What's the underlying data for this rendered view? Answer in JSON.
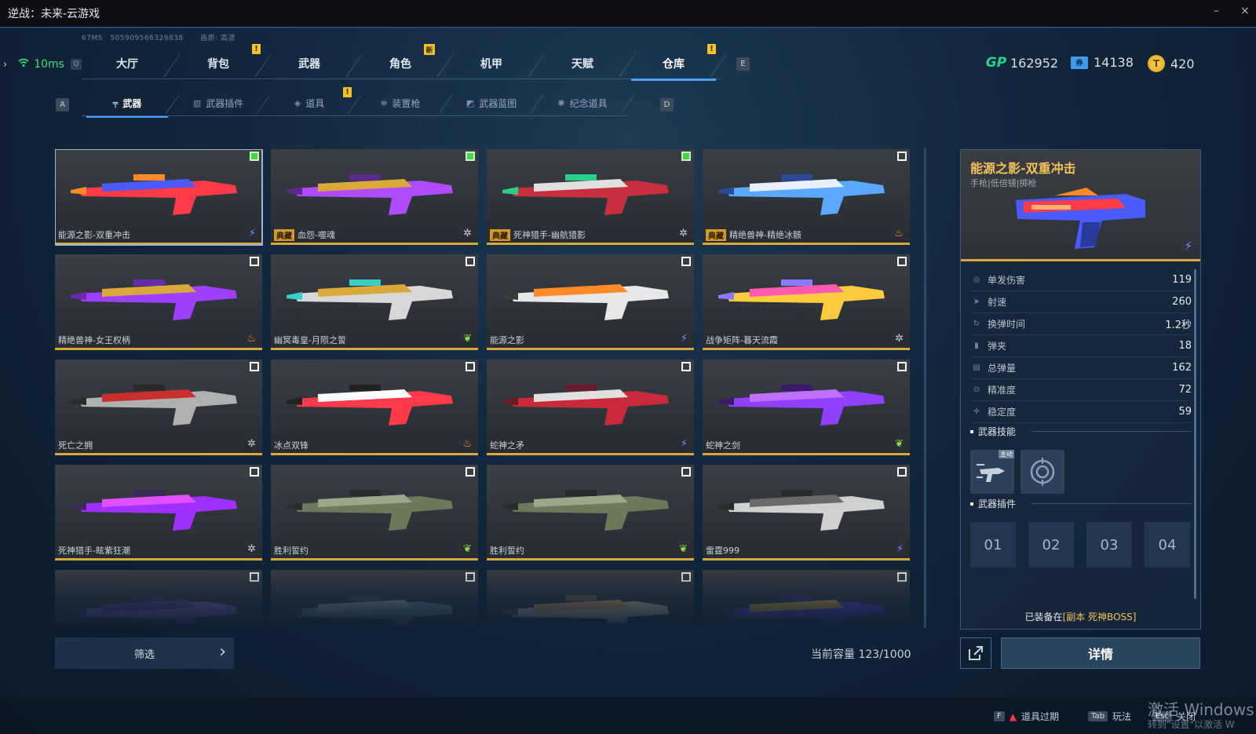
{
  "window": {
    "title": "逆战：未来-云游戏",
    "minimize": "–",
    "close": "×"
  },
  "meta": {
    "latency_small": "67MS",
    "session_id": "505909566329838",
    "quality": "画质: 高清"
  },
  "ping": {
    "label": "10ms",
    "key": "Q"
  },
  "main_tabs": [
    {
      "label": "大厅",
      "badge": ""
    },
    {
      "label": "背包",
      "badge": "!"
    },
    {
      "label": "武器",
      "badge": ""
    },
    {
      "label": "角色",
      "badge": "新"
    },
    {
      "label": "机甲",
      "badge": ""
    },
    {
      "label": "天赋",
      "badge": ""
    },
    {
      "label": "仓库",
      "badge": "!",
      "active": true
    }
  ],
  "main_tabs_key_right": "E",
  "currency": [
    {
      "icon": "gp-icon",
      "symbol": "GP",
      "value": "162952"
    },
    {
      "icon": "ticket-icon",
      "symbol": "券",
      "value": "14138"
    },
    {
      "icon": "coin-icon",
      "symbol": "T",
      "value": "420"
    }
  ],
  "sub_tabs": {
    "key_left": "A",
    "key_right": "D",
    "items": [
      {
        "label": "武器",
        "icon": "gun-icon",
        "active": true
      },
      {
        "label": "武器插件",
        "icon": "chip-icon"
      },
      {
        "label": "道具",
        "icon": "item-icon",
        "badge": "!"
      },
      {
        "label": "装置枪",
        "icon": "device-icon"
      },
      {
        "label": "武器蓝图",
        "icon": "blueprint-icon"
      },
      {
        "label": "纪念道具",
        "icon": "medal-icon"
      }
    ]
  },
  "weapons": [
    {
      "name": "能源之影-双重冲击",
      "tag": "",
      "type": "bolt",
      "checked": true,
      "selected": true,
      "colors": [
        "#ff3b4a",
        "#4a5cff",
        "#ff8a2a"
      ]
    },
    {
      "name": "血怨-噬魂",
      "tag": "典藏",
      "type": "snow",
      "checked": true,
      "colors": [
        "#b04bff",
        "#d8a93a",
        "#5a2a8a"
      ]
    },
    {
      "name": "死神猎手-幽航猎影",
      "tag": "典藏",
      "type": "snow",
      "checked": true,
      "colors": [
        "#c83040",
        "#e0e0e0",
        "#2ad08a"
      ]
    },
    {
      "name": "精绝兽神-精绝冰骸",
      "tag": "典藏",
      "type": "fire",
      "checked": false,
      "colors": [
        "#5aa8ff",
        "#e8f0ff",
        "#2a4a9a"
      ]
    },
    {
      "name": "精绝兽神-女王权柄",
      "tag": "",
      "type": "fire",
      "checked": false,
      "colors": [
        "#a040ff",
        "#d8a93a",
        "#6a2ab0"
      ]
    },
    {
      "name": "幽冥毒皇-月陨之誓",
      "tag": "",
      "type": "leaf",
      "checked": false,
      "colors": [
        "#d8d8d8",
        "#d8a93a",
        "#3ad0c8"
      ]
    },
    {
      "name": "能源之影",
      "tag": "",
      "type": "bolt",
      "checked": false,
      "colors": [
        "#e8e8e8",
        "#ff8a2a",
        "#3a3a3a"
      ]
    },
    {
      "name": "战争矩阵-暮天流霞",
      "tag": "",
      "type": "snow",
      "checked": false,
      "colors": [
        "#ffcc40",
        "#ff5ab0",
        "#8a7aff"
      ]
    },
    {
      "name": "死亡之拥",
      "tag": "",
      "type": "snow",
      "checked": false,
      "colors": [
        "#b0b0b0",
        "#c83030",
        "#2a2a2a"
      ]
    },
    {
      "name": "冰点双锋",
      "tag": "",
      "type": "fire",
      "checked": false,
      "colors": [
        "#ff3a4a",
        "#ffffff",
        "#222222"
      ]
    },
    {
      "name": "蛇神之矛",
      "tag": "",
      "type": "bolt",
      "checked": false,
      "colors": [
        "#c82a3a",
        "#e0e0e0",
        "#6a1a2a"
      ]
    },
    {
      "name": "蛇神之剑",
      "tag": "",
      "type": "leaf",
      "checked": false,
      "colors": [
        "#9040ff",
        "#c070ff",
        "#3a1a6a"
      ]
    },
    {
      "name": "死神猎手-眩紫狂潮",
      "tag": "",
      "type": "snow",
      "checked": false,
      "colors": [
        "#a030ff",
        "#e050ff",
        "#3a2a5a"
      ]
    },
    {
      "name": "胜利誓约",
      "tag": "",
      "type": "leaf",
      "checked": false,
      "colors": [
        "#6a7a5a",
        "#9aa88a",
        "#2a2e2a"
      ]
    },
    {
      "name": "胜利誓约",
      "tag": "",
      "type": "leaf",
      "checked": false,
      "colors": [
        "#6a7a5a",
        "#9aa88a",
        "#2a2e2a"
      ]
    },
    {
      "name": "雷霆999",
      "tag": "",
      "type": "bolt",
      "checked": false,
      "colors": [
        "#d0d0d0",
        "#6a6a6a",
        "#2a2a2a"
      ]
    },
    {
      "name": "",
      "tag": "",
      "type": "",
      "checked": false,
      "colors": [
        "#8a60c8",
        "#5a4a8a",
        "#3a3a5a"
      ]
    },
    {
      "name": "",
      "tag": "",
      "type": "",
      "checked": false,
      "colors": [
        "#6a8a9a",
        "#8aa0b0",
        "#3a4a5a"
      ]
    },
    {
      "name": "",
      "tag": "",
      "type": "",
      "checked": false,
      "colors": [
        "#d8c8a0",
        "#e0a060",
        "#6a5a4a"
      ]
    },
    {
      "name": "",
      "tag": "",
      "type": "",
      "checked": false,
      "colors": [
        "#6040d0",
        "#d8a93a",
        "#3a3a6a"
      ]
    }
  ],
  "filter": {
    "label": "筛选",
    "chevron": "›"
  },
  "capacity": "当前容量 123/1000",
  "detail": {
    "title": "能源之影-双重冲击",
    "subtitle": "手枪|低倍镜|掷枪",
    "stats": [
      {
        "label": "单发伤害",
        "value": "119"
      },
      {
        "label": "射速",
        "value": "260"
      },
      {
        "label": "换弹时间",
        "value": "1.2秒"
      },
      {
        "label": "弹夹",
        "value": "18"
      },
      {
        "label": "总弹量",
        "value": "162"
      },
      {
        "label": "精准度",
        "value": "72"
      },
      {
        "label": "稳定度",
        "value": "59"
      }
    ],
    "skills_title": "武器技能",
    "skill_main_tag": "主动",
    "plugins_title": "武器插件",
    "plugin_slots": [
      "01",
      "02",
      "03",
      "04"
    ],
    "equipped_prefix": "已装备在",
    "equipped_location": "[副本 死神BOSS]",
    "share_icon": "share-icon",
    "detail_button": "详情"
  },
  "bottom_hints": [
    {
      "key": "F",
      "label": "道具过期",
      "warn": true
    },
    {
      "key": "Tab",
      "label": "玩法"
    },
    {
      "key": "Esc",
      "label": "关闭"
    }
  ],
  "watermark": {
    "line1": "激活 Windows",
    "line2": "转到\"设置\"以激活 W"
  },
  "accent_color": "#4ea0ff",
  "rarity_color": "#d8a93a"
}
